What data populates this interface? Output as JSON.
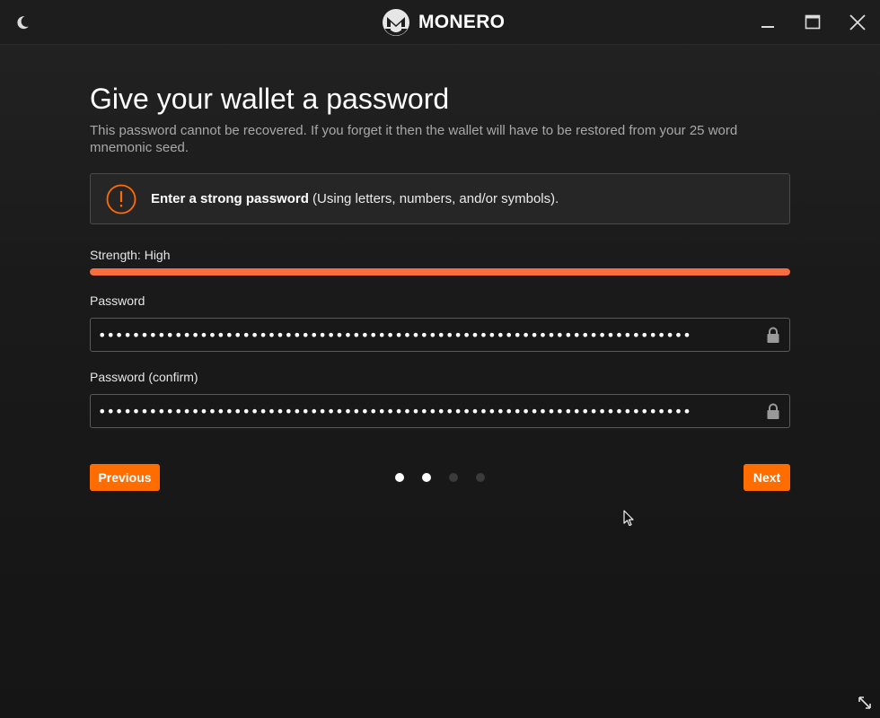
{
  "titlebar": {
    "brand_name": "MONERO",
    "icons": {
      "theme": "moon-icon",
      "logo": "monero-logo",
      "minimize": "minimize-icon",
      "maximize": "maximize-icon",
      "close": "close-icon"
    }
  },
  "page": {
    "title": "Give your wallet a password",
    "description": "This password cannot be recovered. If you forget it then the wallet will have to be restored from your 25 word mnemonic seed."
  },
  "notice": {
    "icon": "warning-circle-icon",
    "strong_text": "Enter a strong password",
    "rest_text": " (Using letters, numbers, and/or symbols)."
  },
  "strength": {
    "label": "Strength: High",
    "level": 1.0
  },
  "password": {
    "label": "Password",
    "value": "••••••••••••••••••••••••••••••••••••••••••••••••••••••••••••••••••••••"
  },
  "password_confirm": {
    "label": "Password (confirm)",
    "value": "••••••••••••••••••••••••••••••••••••••••••••••••••••••••••••••••••••••"
  },
  "navigation": {
    "previous_label": "Previous",
    "next_label": "Next",
    "steps_total": 4,
    "steps_active": [
      true,
      true,
      false,
      false
    ]
  },
  "colors": {
    "accent": "#ff6c00",
    "strength_bar": "#fa6d41",
    "dot_active": "#ffffff",
    "dot_inactive": "#3b3b3b",
    "warning": "#ff6c00"
  }
}
